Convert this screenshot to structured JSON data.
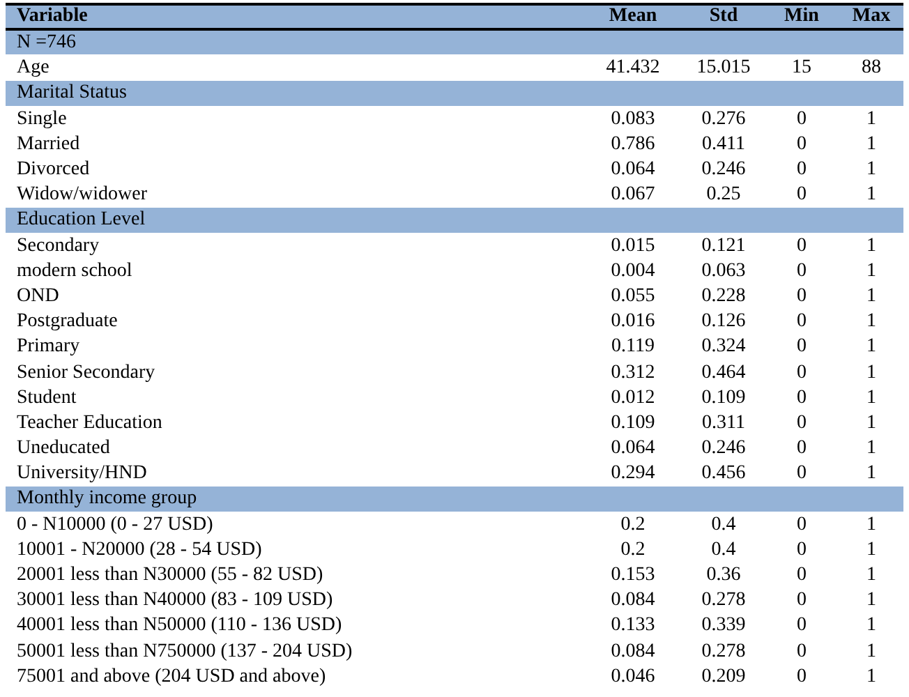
{
  "table": {
    "columns": [
      "Variable",
      "Mean",
      "Std",
      "Min",
      "Max"
    ],
    "rows": [
      {
        "kind": "section",
        "label": "N =746"
      },
      {
        "kind": "data",
        "cells": [
          "Age",
          "41.432",
          "15.015",
          "15",
          "88"
        ]
      },
      {
        "kind": "section",
        "label": "Marital Status"
      },
      {
        "kind": "data",
        "cells": [
          "Single",
          "0.083",
          "0.276",
          "0",
          "1"
        ]
      },
      {
        "kind": "data",
        "cells": [
          "Married",
          "0.786",
          "0.411",
          "0",
          "1"
        ]
      },
      {
        "kind": "data",
        "cells": [
          "Divorced",
          "0.064",
          "0.246",
          "0",
          "1"
        ]
      },
      {
        "kind": "data",
        "cells": [
          "Widow/widower",
          "0.067",
          "0.25",
          "0",
          "1"
        ]
      },
      {
        "kind": "section",
        "label": "Education Level"
      },
      {
        "kind": "data",
        "cells": [
          "Secondary",
          "0.015",
          "0.121",
          "0",
          "1"
        ]
      },
      {
        "kind": "data",
        "cells": [
          "modern school",
          "0.004",
          "0.063",
          "0",
          "1"
        ]
      },
      {
        "kind": "data",
        "cells": [
          "OND",
          "0.055",
          "0.228",
          "0",
          "1"
        ]
      },
      {
        "kind": "data",
        "cells": [
          "Postgraduate",
          "0.016",
          "0.126",
          "0",
          "1"
        ]
      },
      {
        "kind": "data",
        "cells": [
          "Primary",
          "0.119",
          "0.324",
          "0",
          "1"
        ]
      },
      {
        "kind": "data",
        "cells": [
          "Senior Secondary",
          "0.312",
          "0.464",
          "0",
          "1"
        ]
      },
      {
        "kind": "data",
        "cells": [
          "Student",
          "0.012",
          "0.109",
          "0",
          "1"
        ]
      },
      {
        "kind": "data",
        "cells": [
          "Teacher Education",
          "0.109",
          "0.311",
          "0",
          "1"
        ]
      },
      {
        "kind": "data",
        "cells": [
          "Uneducated",
          "0.064",
          "0.246",
          "0",
          "1"
        ]
      },
      {
        "kind": "data",
        "cells": [
          "University/HND",
          "0.294",
          "0.456",
          "0",
          "1"
        ]
      },
      {
        "kind": "section",
        "label": "Monthly income group"
      },
      {
        "kind": "data",
        "cells": [
          "0 - N10000 (0 - 27 USD)",
          "0.2",
          "0.4",
          "0",
          "1"
        ]
      },
      {
        "kind": "data",
        "cells": [
          "10001 - N20000 (28 - 54 USD)",
          "0.2",
          "0.4",
          "0",
          "1"
        ]
      },
      {
        "kind": "data",
        "cells": [
          "20001 less than N30000 (55 - 82 USD)",
          "0.153",
          "0.36",
          "0",
          "1"
        ]
      },
      {
        "kind": "data",
        "cells": [
          "30001 less than N40000 (83 - 109 USD)",
          "0.084",
          "0.278",
          "0",
          "1"
        ]
      },
      {
        "kind": "data",
        "cells": [
          "40001 less than N50000 (110 - 136 USD)",
          "0.133",
          "0.339",
          "0",
          "1"
        ]
      },
      {
        "kind": "data",
        "cells": [
          "50001 less than N750000 (137 - 204 USD)",
          "0.084",
          "0.278",
          "0",
          "1"
        ]
      },
      {
        "kind": "data",
        "cells": [
          "75001 and above (204 USD and above)",
          "0.046",
          "0.209",
          "0",
          "1"
        ]
      }
    ]
  }
}
